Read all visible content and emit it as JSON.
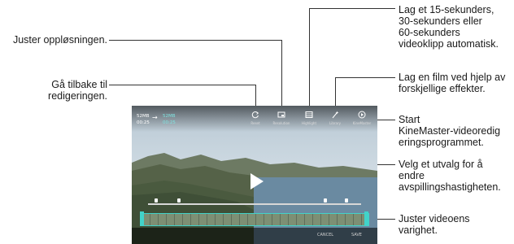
{
  "screen": {
    "original_size": "52MB",
    "original_time": "00:25",
    "new_size": "52MB",
    "new_time": "00:25",
    "arrow": "→",
    "tools": [
      {
        "label": "Reset",
        "icon": "reset-icon"
      },
      {
        "label": "Resolution",
        "icon": "resolution-icon"
      },
      {
        "label": "Highlight",
        "icon": "film-icon"
      },
      {
        "label": "Library",
        "icon": "magic-wand-icon"
      },
      {
        "label": "KineMaster",
        "icon": "kinemaster-icon"
      }
    ],
    "cancel_label": "CANCEL",
    "save_label": "SAVE",
    "speed_markers": 4
  },
  "callouts": {
    "left": [
      "Juster oppløsningen.",
      "Gå tilbake til\nredigeringen."
    ],
    "right": [
      "Lag et 15-sekunders,\n30-sekunders eller\n60-sekunders\nvideoklipp automatisk.",
      "Lag en film ved hjelp av\nforskjellige effekter.",
      "Start\nKineMaster-videoredig\neringsprogrammet.",
      "Velg et utvalg for å\nendre\navspillingshastigheten.",
      "Juster videoens\nvarighet."
    ]
  },
  "colors": {
    "accent": "#42d3c9",
    "line": "#333333"
  }
}
